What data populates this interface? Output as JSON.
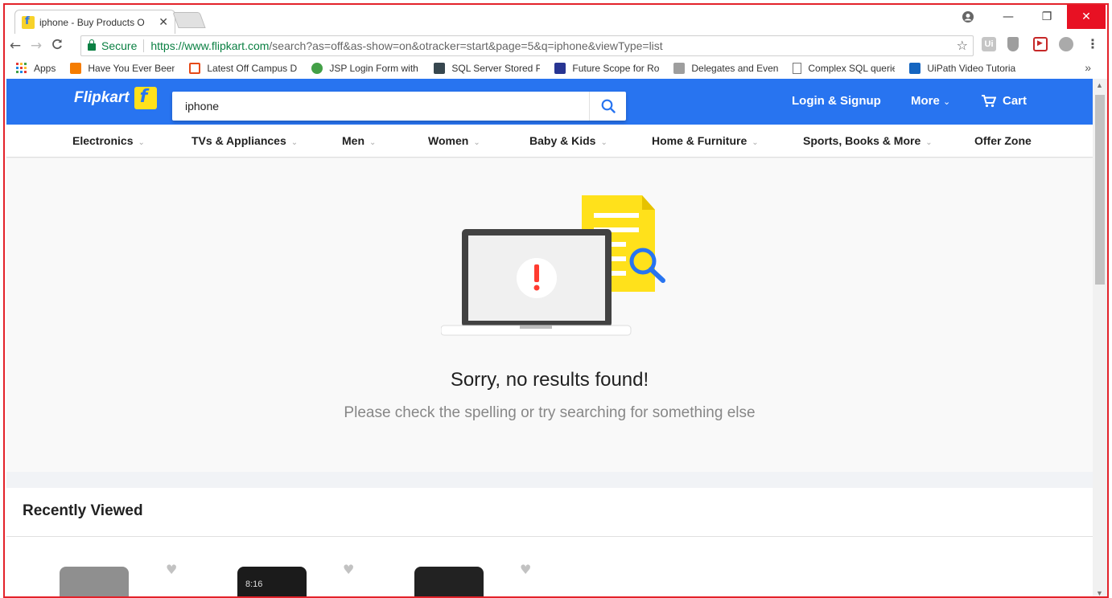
{
  "browser": {
    "tab_title": "iphone - Buy Products O",
    "tab_close": "✕",
    "win_min": "—",
    "win_max": "❐",
    "win_close": "✕",
    "back": "←",
    "forward": "→",
    "reload": "C",
    "secure_label": "Secure",
    "url_base": "https://www.flipkart.com",
    "url_rest": "/search?as=off&as-show=on&otracker=start&page=5&q=iphone&viewType=list",
    "star": "☆",
    "ext_ui_label": "Ui",
    "menu_dots": "⋮"
  },
  "bookmarks": [
    {
      "label": "Apps",
      "color": "#e53935"
    },
    {
      "label": "Have You Ever Been",
      "color": "#f57c00"
    },
    {
      "label": "Latest Off Campus D",
      "color": "#e64a19"
    },
    {
      "label": "JSP Login Form with",
      "color": "#43a047"
    },
    {
      "label": "SQL Server Stored Pr",
      "color": "#37474f"
    },
    {
      "label": "Future Scope for Rol",
      "color": "#283593"
    },
    {
      "label": "Delegates and Event",
      "color": "#9e9e9e"
    },
    {
      "label": "Complex SQL querie",
      "color": "#ffffff"
    },
    {
      "label": "UiPath Video Tutoria",
      "color": "#1565c0"
    }
  ],
  "bookmarks_more": "»",
  "header": {
    "logo_text": "Flipkart",
    "search_value": "iphone",
    "login_label": "Login & Signup",
    "more_label": "More",
    "more_chev": "⌄",
    "cart_label": "Cart",
    "brand_color": "#2874f0"
  },
  "categories": [
    {
      "label": "Electronics",
      "chev": "⌄"
    },
    {
      "label": "TVs & Appliances",
      "chev": "⌄"
    },
    {
      "label": "Men",
      "chev": "⌄"
    },
    {
      "label": "Women",
      "chev": "⌄"
    },
    {
      "label": "Baby & Kids",
      "chev": "⌄"
    },
    {
      "label": "Home & Furniture",
      "chev": "⌄"
    },
    {
      "label": "Sports, Books & More",
      "chev": "⌄"
    },
    {
      "label": "Offer Zone",
      "chev": ""
    }
  ],
  "empty_state": {
    "title": "Sorry, no results found!",
    "subtitle": "Please check the spelling or try searching for something else"
  },
  "recently_viewed": {
    "heading": "Recently Viewed",
    "heart": "♥",
    "phone_time": "8:16"
  },
  "scrollbar": {
    "up": "▲",
    "down": "▼"
  }
}
